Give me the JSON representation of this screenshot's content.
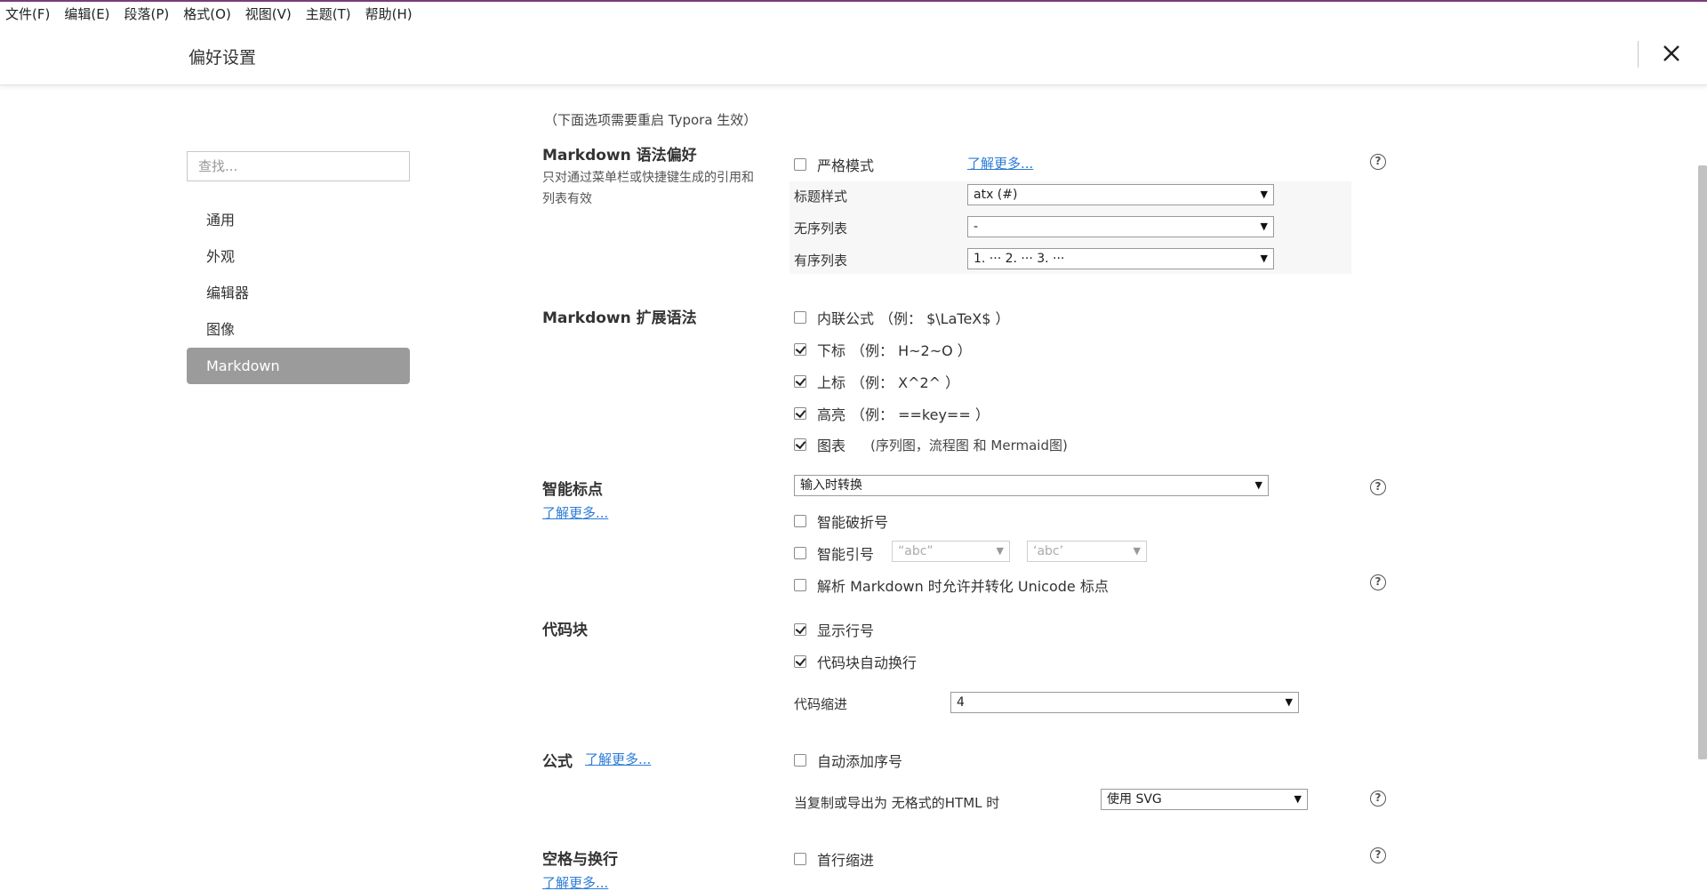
{
  "menubar": {
    "items": [
      "文件(F)",
      "编辑(E)",
      "段落(P)",
      "格式(O)",
      "视图(V)",
      "主题(T)",
      "帮助(H)"
    ]
  },
  "header": {
    "title": "偏好设置"
  },
  "sidebar": {
    "search_placeholder": "查找...",
    "items": [
      "通用",
      "外观",
      "编辑器",
      "图像",
      "Markdown"
    ],
    "active": "Markdown"
  },
  "restart_note": "（下面选项需要重启 Typora 生效）",
  "sections": {
    "syntax_pref": {
      "title": "Markdown 语法偏好",
      "description": "只对通过菜单栏或快捷键生成的引用和列表有效",
      "strict_mode": {
        "label": "严格模式",
        "checked": false
      },
      "learn_more": "了解更多...",
      "heading_style": {
        "label": "标题样式",
        "value": "atx (#)"
      },
      "unordered_list": {
        "label": "无序列表",
        "value": "-"
      },
      "ordered_list": {
        "label": "有序列表",
        "value": "1. ··· 2. ··· 3. ···"
      }
    },
    "extended_syntax": {
      "title": "Markdown 扩展语法",
      "inline_math": {
        "label": "内联公式",
        "example": "（例： $\\LaTeX$ ）",
        "checked": false
      },
      "subscript": {
        "label": "下标",
        "example": "（例： H~2~O ）",
        "checked": true
      },
      "superscript": {
        "label": "上标",
        "example": "（例： X^2^ ）",
        "checked": true
      },
      "highlight": {
        "label": "高亮",
        "example": "（例： ==key== ）",
        "checked": true
      },
      "diagrams": {
        "label": "图表",
        "example": "(序列图，流程图 和 Mermaid图)",
        "checked": true
      }
    },
    "smart_punctuation": {
      "title": "智能标点",
      "learn_more": "了解更多...",
      "mode": "输入时转换",
      "smart_dash": {
        "label": "智能破折号",
        "checked": false
      },
      "smart_quotes": {
        "label": "智能引号",
        "checked": false,
        "double_value": "“abc”",
        "single_value": "‘abc’"
      },
      "unicode_punct": {
        "label": "解析 Markdown 时允许并转化 Unicode 标点",
        "checked": false
      }
    },
    "code_block": {
      "title": "代码块",
      "line_numbers": {
        "label": "显示行号",
        "checked": true
      },
      "wrap": {
        "label": "代码块自动换行",
        "checked": true
      },
      "indent": {
        "label": "代码缩进",
        "value": "4"
      }
    },
    "math": {
      "title": "公式",
      "learn_more": "了解更多...",
      "auto_number": {
        "label": "自动添加序号",
        "checked": false
      },
      "export_label": "当复制或导出为 无格式的HTML 时",
      "export_value": "使用 SVG"
    },
    "whitespace": {
      "title": "空格与换行",
      "learn_more": "了解更多...",
      "first_line_indent": {
        "label": "首行缩进",
        "checked": false
      }
    }
  },
  "help_glyph": "?",
  "icons": [
    "close-icon",
    "help-icon",
    "chevron-down-icon",
    "checkbox-icon"
  ]
}
